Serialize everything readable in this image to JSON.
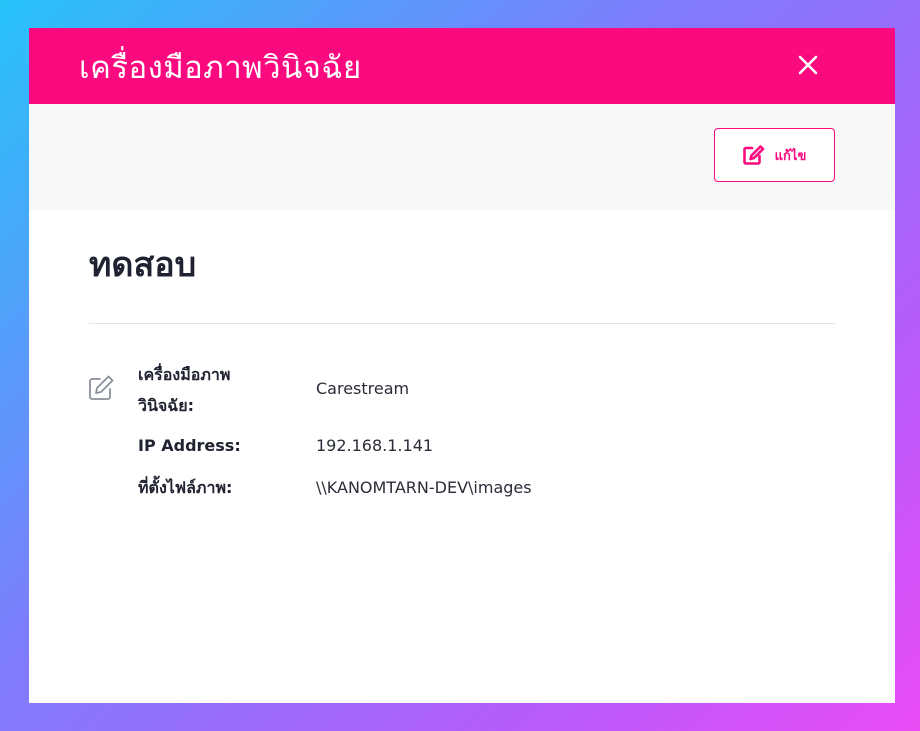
{
  "dialog": {
    "title": "เครื่องมือภาพวินิจฉัย",
    "close_icon": "close-icon"
  },
  "toolbar": {
    "edit_label": "แก้ไข",
    "edit_icon": "edit-icon"
  },
  "record": {
    "title": "ทดสอบ",
    "row_icon": "edit-icon",
    "fields": [
      {
        "label_line1": "เครื่องมือภาพ",
        "label_line2": "วินิจฉัย:",
        "value": "Carestream"
      },
      {
        "label": "IP Address:",
        "value": "192.168.1.141"
      },
      {
        "label": "ที่ตั้งไฟล์ภาพ:",
        "value": "\\\\KANOMTARN-DEV\\images"
      }
    ]
  },
  "colors": {
    "accent": "#fb0a7f",
    "toolbar_bg": "#f7f8fa",
    "text": "#1f2230"
  }
}
